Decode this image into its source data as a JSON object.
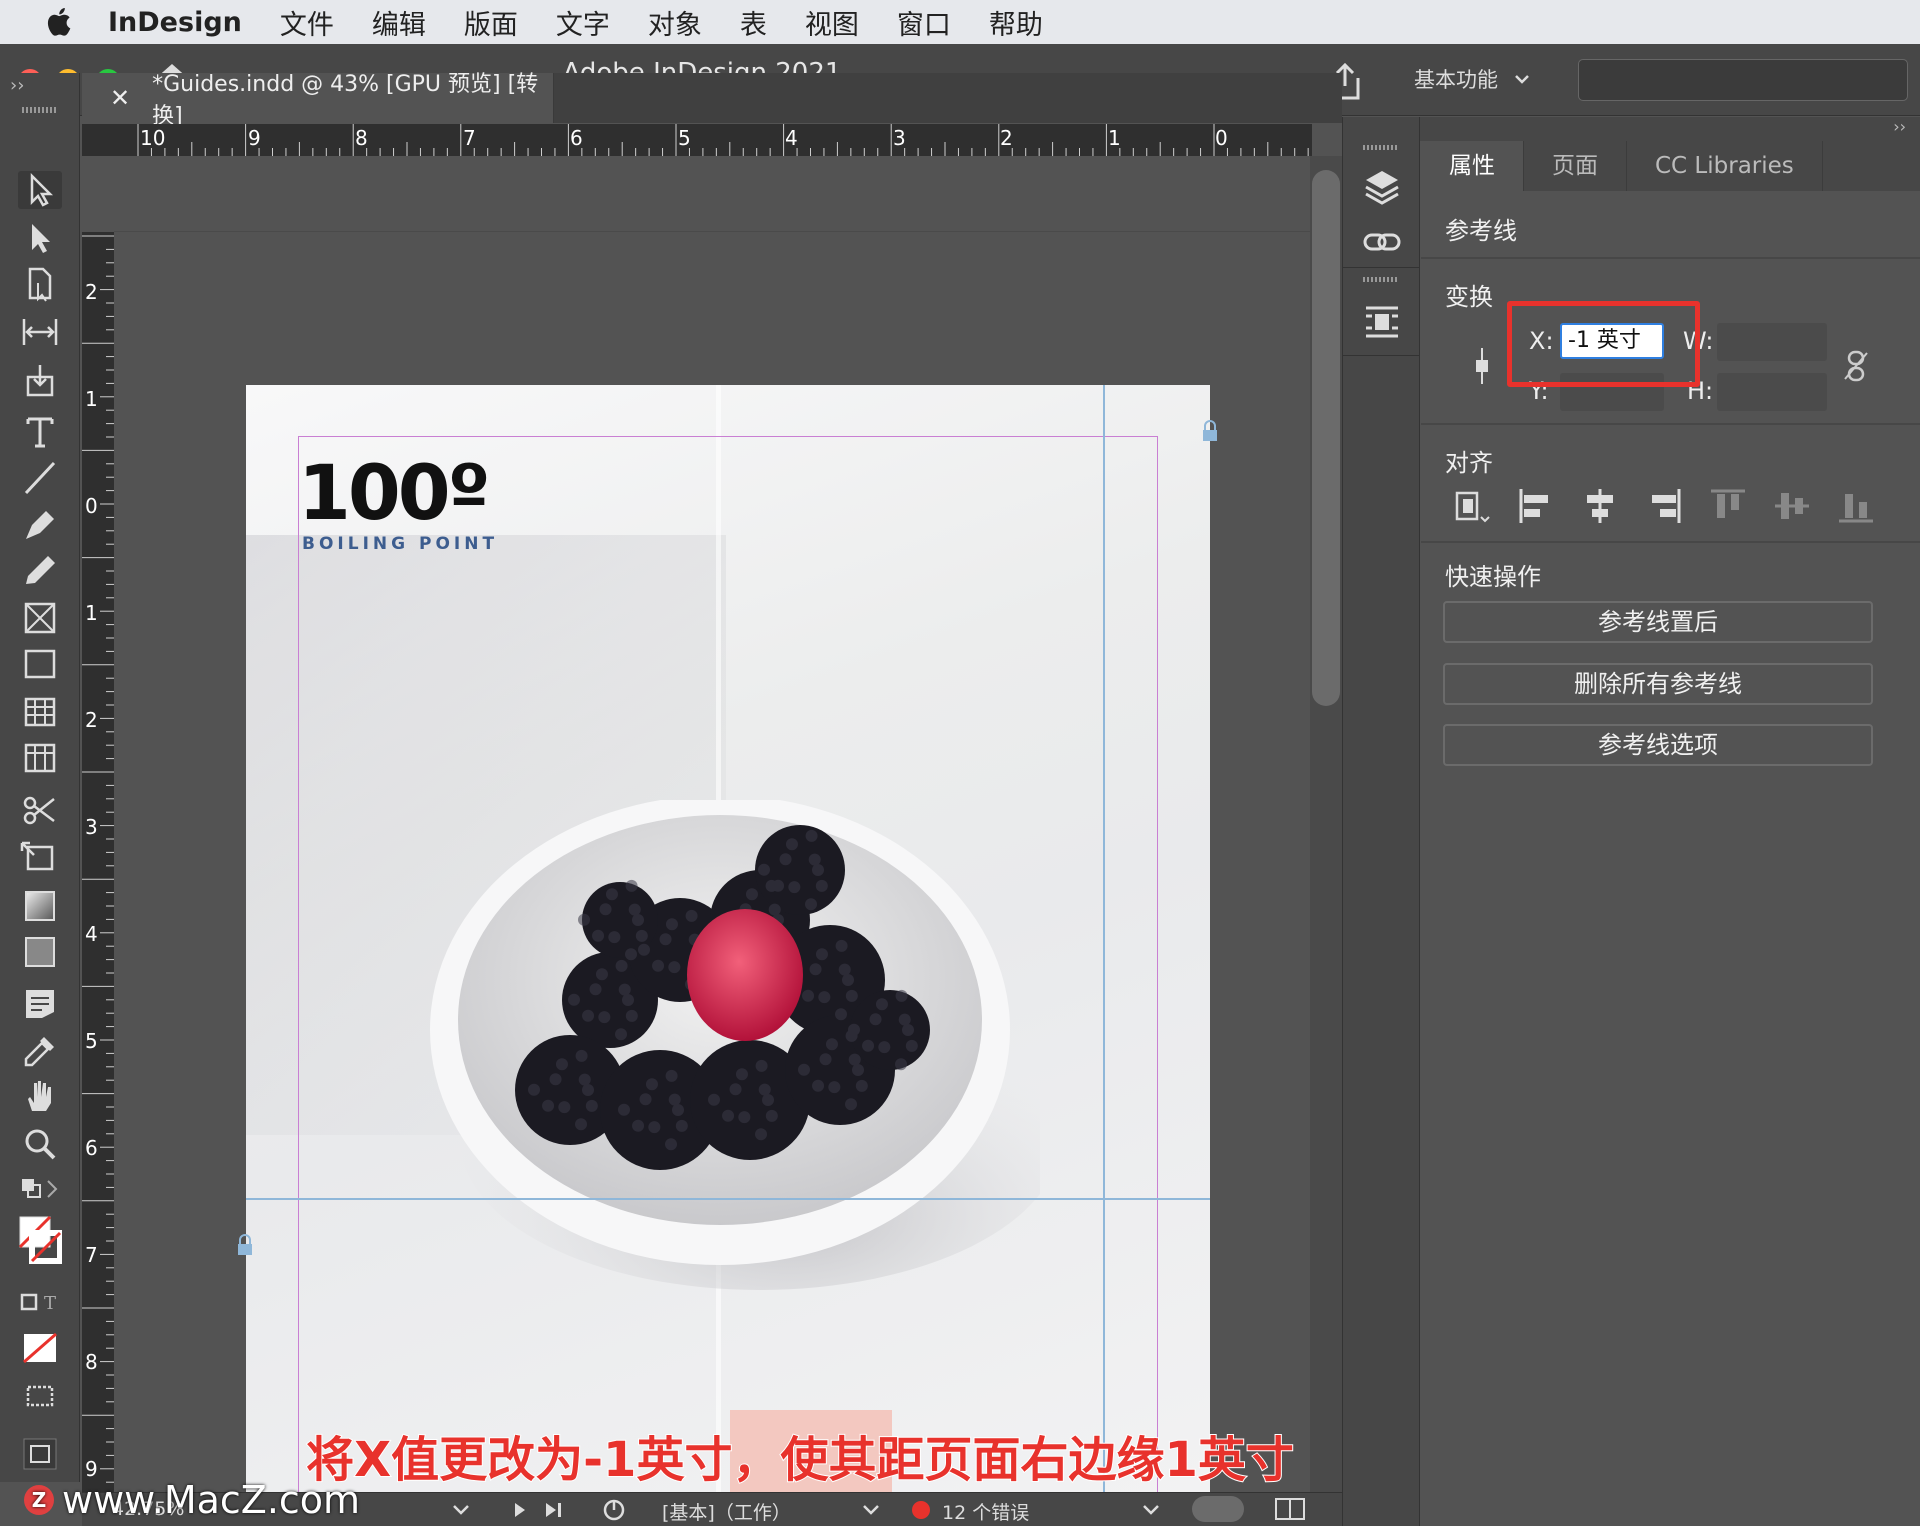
{
  "menubar": {
    "app_name": "InDesign",
    "items": [
      "文件",
      "编辑",
      "版面",
      "文字",
      "对象",
      "表",
      "视图",
      "窗口",
      "帮助"
    ]
  },
  "window": {
    "title": "Adobe InDesign 2021",
    "workspace_label": "基本功能",
    "search_placeholder": ""
  },
  "document": {
    "tab_title": "*Guides.indd @ 43% [GPU 预览] [转换]",
    "h_ruler_labels": [
      "10",
      "9",
      "8",
      "7",
      "6",
      "5",
      "4",
      "3",
      "2",
      "1",
      "0"
    ],
    "v_ruler_labels": [
      "2",
      "1",
      "0",
      "1",
      "2",
      "3",
      "4",
      "5",
      "6",
      "7",
      "8",
      "9"
    ]
  },
  "page_content": {
    "logo_number": "100º",
    "logo_subtitle": "BOILING POINT"
  },
  "caption": "将X值更改为-1英寸，使其距页面右边缘1英寸",
  "watermark": "www.MacZ.com",
  "statusbar": {
    "zoom": "42.75%",
    "profile": "[基本]（工作）",
    "errors": "12 个错误"
  },
  "properties_panel": {
    "tabs": [
      "属性",
      "页面",
      "CC Libraries"
    ],
    "active_tab": "属性",
    "context_title": "参考线",
    "transform_heading": "变换",
    "x_label": "X:",
    "x_value": "-1 英寸",
    "y_label": "Y:",
    "w_label": "W:",
    "h_label": "H:",
    "align_heading": "对齐",
    "quick_actions_heading": "快速操作",
    "quick_actions": [
      "参考线置后",
      "删除所有参考线",
      "参考线选项"
    ]
  },
  "colors": {
    "highlight_box": "#e8322c",
    "caption": "#e8322c",
    "margin_guide": "#c97fd3",
    "ruler_guide": "#8fb7d9"
  }
}
